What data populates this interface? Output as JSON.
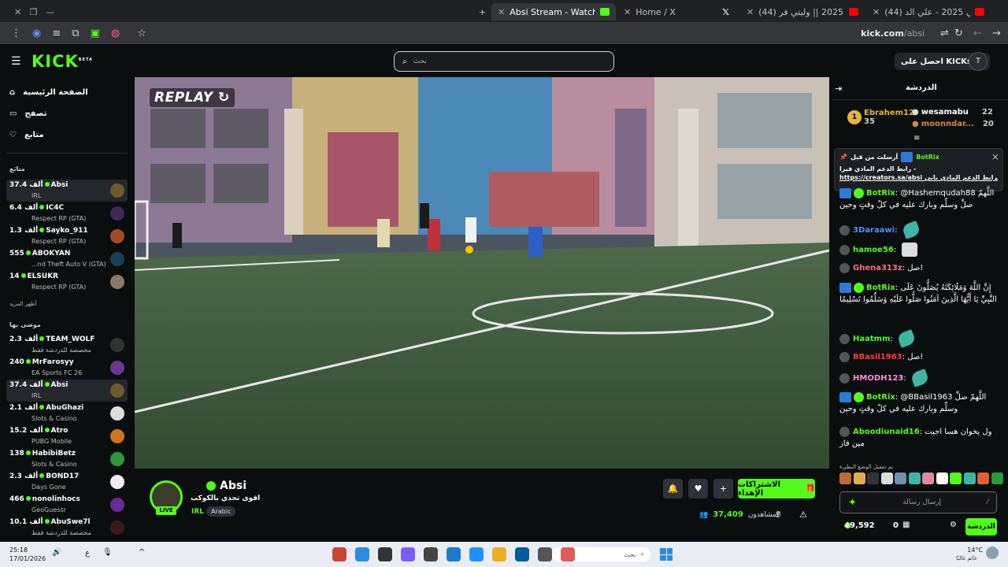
{
  "browser": {
    "tabs": [
      {
        "title": "(44) اغاني عراقي 2025 - علي الد..."
      },
      {
        "title": "(44) اغاني ليبية 2025 || وليتي فر..."
      },
      {
        "title": "Home / X"
      },
      {
        "title": "Absi Stream - Watch Live on Kick"
      }
    ],
    "url_domain": "kick.com",
    "url_path": "/absi"
  },
  "header": {
    "logo": "KICK",
    "logo_tag": "BETA",
    "search_placeholder": "بحث",
    "get_kicks": "احصل على KICKs",
    "user_initial": "T"
  },
  "sidebar": {
    "nav": [
      {
        "label": "الصفحة الرئيسية",
        "icon": "home-icon"
      },
      {
        "label": "تصفح",
        "icon": "browse-icon"
      },
      {
        "label": "متابع",
        "icon": "heart-icon"
      }
    ],
    "following_heading": "متابَع",
    "following": [
      {
        "viewers": "37.4 ألف",
        "name": "Absi",
        "category": "IRL",
        "selected": true,
        "color": "#6b5b2a"
      },
      {
        "viewers": "6.4 ألف",
        "name": "IC4C",
        "category": "Respect RP (GTA)",
        "color": "#3a2a55"
      },
      {
        "viewers": "1.3 ألف",
        "name": "Sayko_911",
        "category": "Respect RP (GTA)",
        "color": "#a34a2a"
      },
      {
        "viewers": "555",
        "name": "ABOKYAN",
        "category": "...nd Theft Auto V (GTA)",
        "color": "#1d3d55"
      },
      {
        "viewers": "14",
        "name": "ELSUKR",
        "category": "Respect RP (GTA)",
        "color": "#8a7a6a"
      }
    ],
    "show_more_1": "أظهر المزيد",
    "recommended_heading": "موصى بها",
    "recommended": [
      {
        "viewers": "2.3 ألف",
        "name": "TEAM_WOLF",
        "category": "مخصصة للدردشة فقط",
        "color": "#333"
      },
      {
        "viewers": "240",
        "name": "MrFarosyy",
        "category": "EA Sports FC 26",
        "color": "#6a3a8a"
      },
      {
        "viewers": "37.4 ألف",
        "name": "Absi",
        "category": "IRL",
        "selected": true,
        "color": "#6b5b2a"
      },
      {
        "viewers": "2.1 ألف",
        "name": "AbuGhazi",
        "category": "Slots & Casino",
        "color": "#ddd"
      },
      {
        "viewers": "15.2 ألف",
        "name": "Atro",
        "category": "PUBG Mobile",
        "color": "#d0741a"
      },
      {
        "viewers": "138",
        "name": "HabibiBetz",
        "category": "Slots & Casino",
        "color": "#2a9a3a"
      },
      {
        "viewers": "2.3 ألف",
        "name": "BOND17",
        "category": "Days Gone",
        "color": "#eee"
      },
      {
        "viewers": "466",
        "name": "nonolinhocs",
        "category": "GeoGuessr",
        "color": "#6a2a9a"
      },
      {
        "viewers": "10.1 ألف",
        "name": "AbuSwe7l",
        "category": "مخصصة للدردشة فقط",
        "color": "#3a1a1a"
      }
    ]
  },
  "video": {
    "replay_label": "REPLAY"
  },
  "stream": {
    "live_label": "LIVE",
    "name": "Absi",
    "title": "اقوى تحدي بالكوكب",
    "category": "IRL",
    "language": "Arabic",
    "gift_subs_label": "الاشتراكات الإهداء",
    "viewers_label": "المشاهدون",
    "viewers_count": "37,409"
  },
  "chat": {
    "title": "الدردشة",
    "leaderboard": [
      {
        "name": "Ebrahem12",
        "count": "35"
      },
      {
        "name": "wesamabu",
        "count": "22"
      },
      {
        "name": "moonndar...",
        "count": "20"
      }
    ],
    "pinned_by": "أرسلت من قبل",
    "pinned_user": "BotRix",
    "pinned_line1": "رابط الدعم المادي فيزا -",
    "pinned_line2": "https://creators.sa/absi طرابط الدعم المادي بابي",
    "messages": [
      {
        "user": "BotRix",
        "color": "#53fc18",
        "text": "@Hashemqudah88 اللَّهمّ صلِّ وسلِّم وبارك عليه في كلّ وقتٍ وحين"
      },
      {
        "user": "3Daraawi",
        "color": "#5a8cff",
        "text": ""
      },
      {
        "user": "hamoe56",
        "color": "#53fc18",
        "text": ""
      },
      {
        "user": "Ghena313z",
        "color": "#ff6b8a",
        "text": "صل!"
      },
      {
        "user": "BotRix",
        "color": "#53fc18",
        "text": "إِنَّ اللَّهَ وَمَلَائِكَتَهُ يُصَلُّونَ عَلَى النَّبِيِّ يَا أَيُّهَا الَّذِينَ آمَنُوا صَلُّوا عَلَيْهِ وَسَلِّمُوا تَسْلِيمًا"
      },
      {
        "user": "Haatmm",
        "color": "#53fc18",
        "text": ""
      },
      {
        "user": "BBasil1963",
        "color": "#ff3b3b",
        "text": "صل!"
      },
      {
        "user": "HMODH123",
        "color": "#ff8fd0",
        "text": ""
      },
      {
        "user": "BotRix",
        "color": "#53fc18",
        "text": "@BBasil1963 اللَّهمّ صلِّ وسلِّم وبارك عليه في كلّ وقتٍ وحين"
      },
      {
        "user": "Aboodiunaid16",
        "color": "#53fc18",
        "text": "ول يخوان هسا اجيت مين فاز"
      }
    ],
    "emote_mode_note": "تم تفعيل الوضع البطيء",
    "input_placeholder": "إرسال رسالة",
    "points": "49,592",
    "kicks": "0",
    "chat_button": "الدردشة"
  },
  "taskbar": {
    "time": "25:18",
    "date": "17/01/2026",
    "search_placeholder": "بحث",
    "weather_temp": "14°C",
    "weather_desc": "غائم غالبًا",
    "lang": "ع"
  }
}
